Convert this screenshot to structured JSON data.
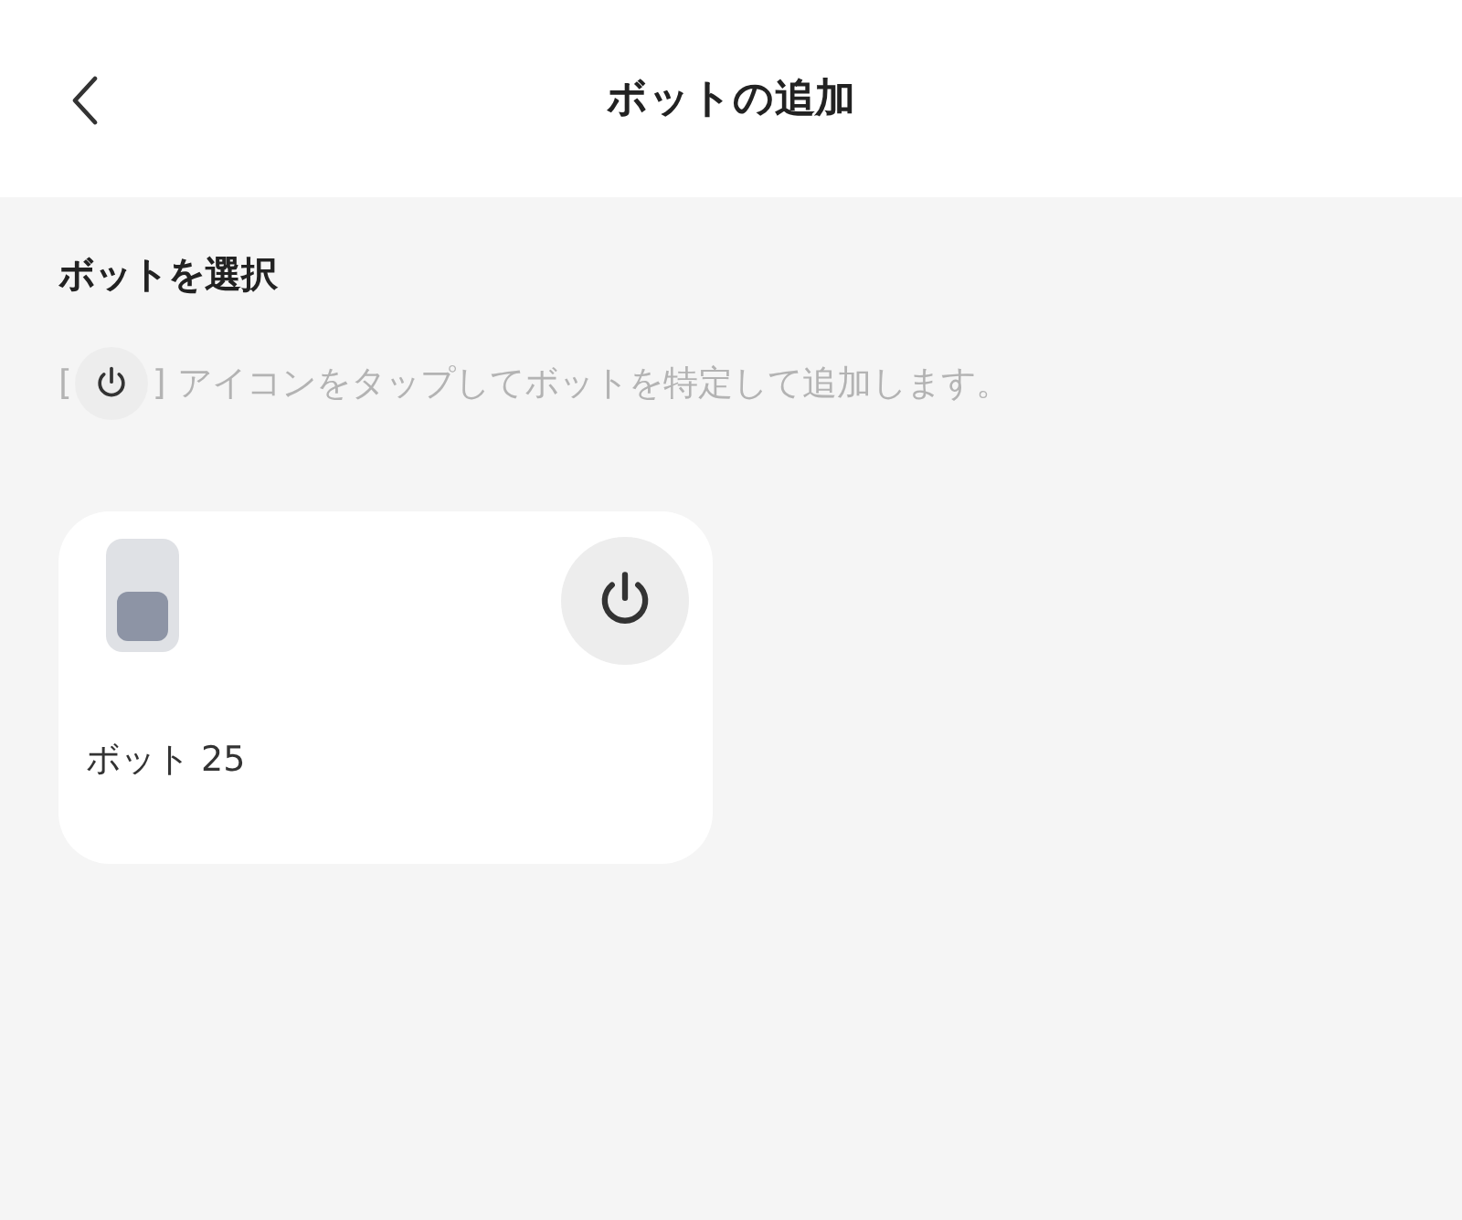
{
  "header": {
    "title": "ボットの追加"
  },
  "section": {
    "heading": "ボットを選択",
    "hint_before": "[",
    "hint_after": "] アイコンをタップしてボットを特定して追加します。"
  },
  "bots": [
    {
      "name": "ボット 25"
    }
  ]
}
